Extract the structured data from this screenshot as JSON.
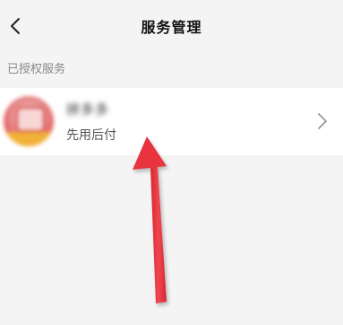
{
  "nav": {
    "title": "服务管理",
    "back_icon": "chevron-left-icon"
  },
  "section": {
    "label": "已授权服务"
  },
  "service": {
    "name": "拼多多",
    "subtitle": "先用后付",
    "logo_icon": "app-logo-icon",
    "chevron_icon": "chevron-right-icon"
  },
  "annotation": {
    "arrow_icon": "red-arrow-up-icon",
    "color": "#e8343f"
  },
  "colors": {
    "background": "#f4f4f4",
    "card": "#ffffff",
    "section_text": "#888888"
  }
}
